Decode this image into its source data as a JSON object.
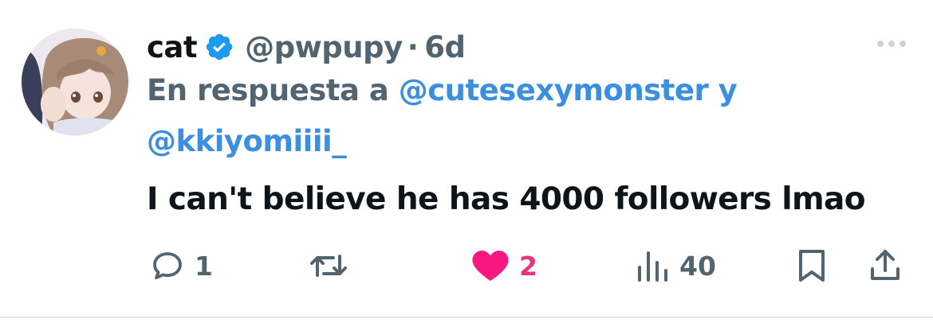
{
  "tweet": {
    "display_name": "cat",
    "handle": "@pwpupy",
    "separator": "·",
    "time": "6d",
    "reply_prefix": "En respuesta a",
    "reply_mention_1": "@cutesexymonster",
    "reply_joiner": "y",
    "reply_mention_2": "@kkiyomiiii_",
    "text": "I can't believe he has 4000 followers lmao"
  },
  "actions": {
    "reply_count": "1",
    "retweet_count": "",
    "like_count": "2",
    "views_count": "40"
  },
  "icons": {
    "verified": "verified-badge-icon",
    "more": "more-icon",
    "reply": "reply-icon",
    "retweet": "retweet-icon",
    "like": "heart-icon",
    "views": "views-icon",
    "bookmark": "bookmark-icon",
    "share": "share-icon"
  },
  "colors": {
    "accent": "#1d9bf0",
    "like": "#f91880",
    "muted": "#536471",
    "text": "#0f1419"
  }
}
